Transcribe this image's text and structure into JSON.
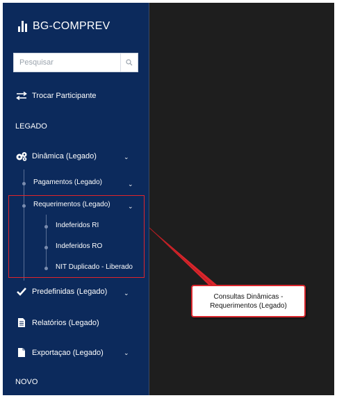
{
  "app": {
    "title": "BG-COMPREV"
  },
  "search": {
    "placeholder": "Pesquisar"
  },
  "menu": {
    "switch_participant": "Trocar Participante",
    "section_legacy": "LEGADO",
    "dynamic": "Dinâmica (Legado)",
    "payments": "Pagamentos (Legado)",
    "requirements": "Requerimentos (Legado)",
    "rejected_ri": "Indeferidos RI",
    "rejected_ro": "Indeferidos RO",
    "nit_duplicate": "NIT Duplicado - Liberado",
    "predefined": "Predefinidas (Legado)",
    "reports": "Relatórios (Legado)",
    "export": "Exportaçao (Legado)",
    "section_new": "NOVO"
  },
  "annotation": {
    "line1": "Consultas Dinâmicas -",
    "line2": "Requerimentos (Legado)"
  },
  "colors": {
    "sidebar": "#0c2a5c",
    "highlight": "#e1242b",
    "backdrop": "#1e1e1e"
  },
  "icons": [
    "bar-chart-icon",
    "search-icon",
    "swap-arrows-icon",
    "cogs-icon",
    "chevron-down-icon",
    "checkmark-icon",
    "document-icon",
    "file-icon"
  ]
}
